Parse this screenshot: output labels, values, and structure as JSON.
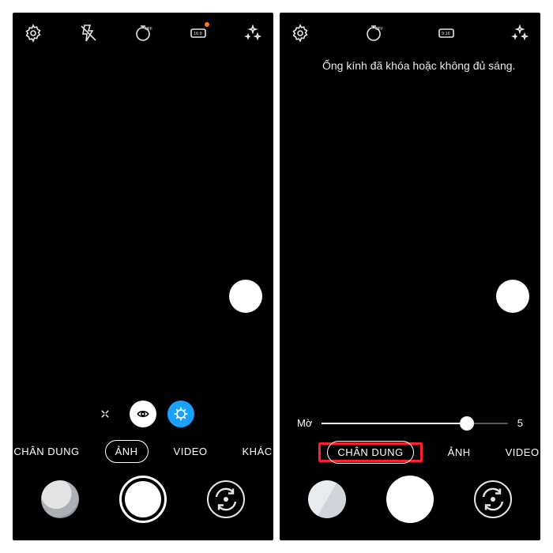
{
  "left": {
    "modes": {
      "portrait": "CHÂN DUNG",
      "photo": "ẢNH",
      "video": "VIDEO",
      "other": "KHÁC",
      "selected": "ẢNH"
    }
  },
  "right": {
    "message": "Ống kính đã khóa hoặc không đủ sáng.",
    "slider": {
      "label": "Mờ",
      "value": "5",
      "percent": 78
    },
    "modes": {
      "portrait": "CHÂN DUNG",
      "photo": "ẢNH",
      "video": "VIDEO",
      "selected": "CHÂN DUNG"
    }
  }
}
